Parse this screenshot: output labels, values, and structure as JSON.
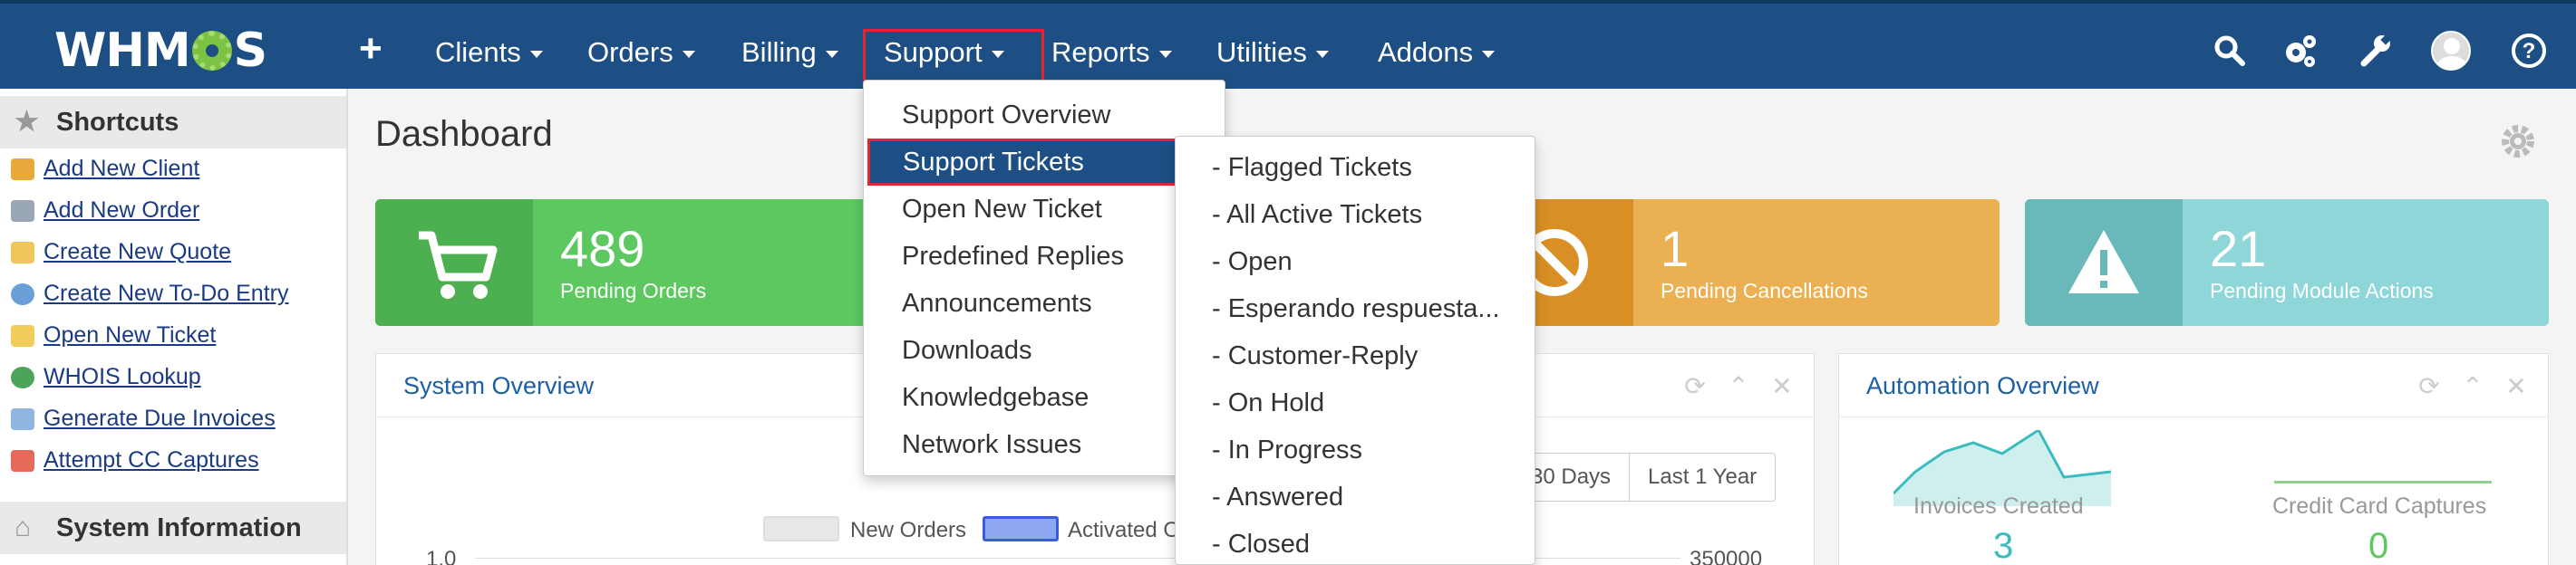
{
  "brand": {
    "logo_text_left": "WHM",
    "logo_text_right": "S"
  },
  "nav": {
    "plus": "+",
    "items": [
      {
        "label": "Clients"
      },
      {
        "label": "Orders"
      },
      {
        "label": "Billing"
      },
      {
        "label": "Support"
      },
      {
        "label": "Reports"
      },
      {
        "label": "Utilities"
      },
      {
        "label": "Addons"
      }
    ],
    "icons": [
      "search-icon",
      "cogs-icon",
      "wrench-icon",
      "avatar",
      "help-icon"
    ]
  },
  "sidebar": {
    "shortcuts_title": "Shortcuts",
    "shortcuts": [
      {
        "label": "Add New Client",
        "icon": "add-client-icon"
      },
      {
        "label": "Add New Order",
        "icon": "cart-icon"
      },
      {
        "label": "Create New Quote",
        "icon": "quote-icon"
      },
      {
        "label": "Create New To-Do Entry",
        "icon": "todo-icon"
      },
      {
        "label": "Open New Ticket",
        "icon": "ticket-icon"
      },
      {
        "label": "WHOIS Lookup",
        "icon": "globe-icon"
      },
      {
        "label": "Generate Due Invoices",
        "icon": "invoice-icon"
      },
      {
        "label": "Attempt CC Captures",
        "icon": "card-icon"
      }
    ],
    "system_info_title": "System Information"
  },
  "page": {
    "title": "Dashboard"
  },
  "stats": [
    {
      "value": "489",
      "label": "Pending Orders",
      "color": "#5cc85f",
      "icon_color": "#4caf50"
    },
    {
      "value": "1",
      "label": "Pending Cancellations",
      "color": "#eab051",
      "icon_color": "#d98f23"
    },
    {
      "value": "21",
      "label": "Pending Module Actions",
      "color": "#8ed6d8",
      "icon_color": "#69b9bb"
    }
  ],
  "panels": {
    "system_overview": {
      "title": "System Overview"
    },
    "automation_overview": {
      "title": "Automation Overview"
    }
  },
  "range_buttons": [
    "30 Days",
    "Last 1 Year"
  ],
  "chart_legend": {
    "new_orders": "New Orders",
    "activated": "Activated O"
  },
  "chart_axis": {
    "left_tick": "1.0",
    "right_tick": "350000"
  },
  "automation": {
    "invoices_created_label": "Invoices Created",
    "invoices_created_value": "3",
    "cc_captures_label": "Credit Card Captures",
    "cc_captures_value": "0"
  },
  "support_menu": [
    {
      "label": "Support Overview"
    },
    {
      "label": "Support Tickets"
    },
    {
      "label": "Open New Ticket"
    },
    {
      "label": "Predefined Replies"
    },
    {
      "label": "Announcements"
    },
    {
      "label": "Downloads"
    },
    {
      "label": "Knowledgebase"
    },
    {
      "label": "Network Issues"
    }
  ],
  "tickets_submenu": [
    {
      "label": "- Flagged Tickets"
    },
    {
      "label": "- All Active Tickets"
    },
    {
      "label": "- Open"
    },
    {
      "label": "- Esperando respuesta..."
    },
    {
      "label": "- Customer-Reply"
    },
    {
      "label": "- On Hold"
    },
    {
      "label": "- In Progress"
    },
    {
      "label": "- Answered"
    },
    {
      "label": "- Closed"
    }
  ],
  "colors": {
    "nav_bg": "#1d4f84",
    "highlight_border": "#e3262d",
    "link": "#1a3a82",
    "panel_title": "#1d5fa3",
    "teal_value": "#3cbcbf"
  }
}
